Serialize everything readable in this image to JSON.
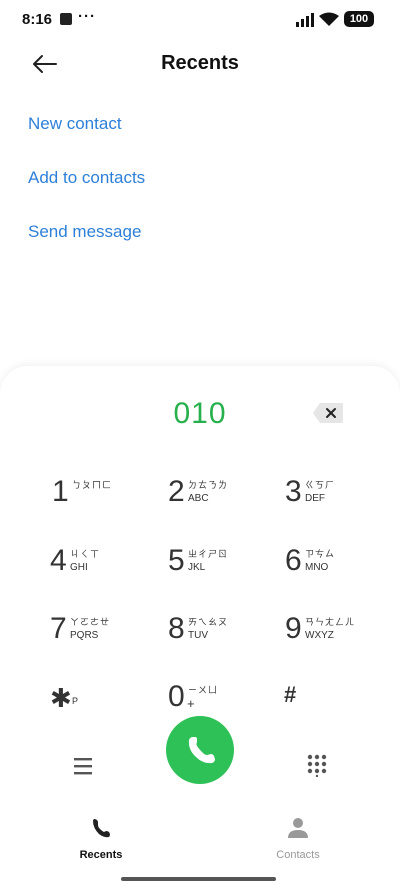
{
  "status_bar": {
    "time": "8:16",
    "overflow": "···",
    "battery": "100"
  },
  "header": {
    "title": "Recents"
  },
  "actions": {
    "new_contact": "New contact",
    "add_to_contacts": "Add to contacts",
    "send_message": "Send message"
  },
  "dialer": {
    "number": "010",
    "keys": [
      {
        "digit": "1",
        "bopomofo": "ㄅㄆㄇㄈ",
        "letters": ""
      },
      {
        "digit": "2",
        "bopomofo": "ㄉㄊㄋㄌ",
        "letters": "ABC"
      },
      {
        "digit": "3",
        "bopomofo": "ㄍㄎㄏ",
        "letters": "DEF"
      },
      {
        "digit": "4",
        "bopomofo": "ㄐㄑㄒ",
        "letters": "GHI"
      },
      {
        "digit": "5",
        "bopomofo": "ㄓㄔㄕㄖ",
        "letters": "JKL"
      },
      {
        "digit": "6",
        "bopomofo": "ㄗㄘㄙ",
        "letters": "MNO"
      },
      {
        "digit": "7",
        "bopomofo": "ㄚㄛㄜㄝ",
        "letters": "PQRS"
      },
      {
        "digit": "8",
        "bopomofo": "ㄞㄟㄠㄡ",
        "letters": "TUV"
      },
      {
        "digit": "9",
        "bopomofo": "ㄢㄣㄤㄥㄦ",
        "letters": "WXYZ"
      }
    ],
    "star": {
      "symbol": "✱",
      "sub": "P"
    },
    "zero": {
      "digit": "0",
      "bopomofo": "ㄧㄨㄩ",
      "plus": "+"
    },
    "hash": "#"
  },
  "bottom_nav": {
    "recents": "Recents",
    "contacts": "Contacts"
  },
  "colors": {
    "accent": "#2d7fd8",
    "dial_green": "#2ec157",
    "number_green": "#27b14d"
  }
}
